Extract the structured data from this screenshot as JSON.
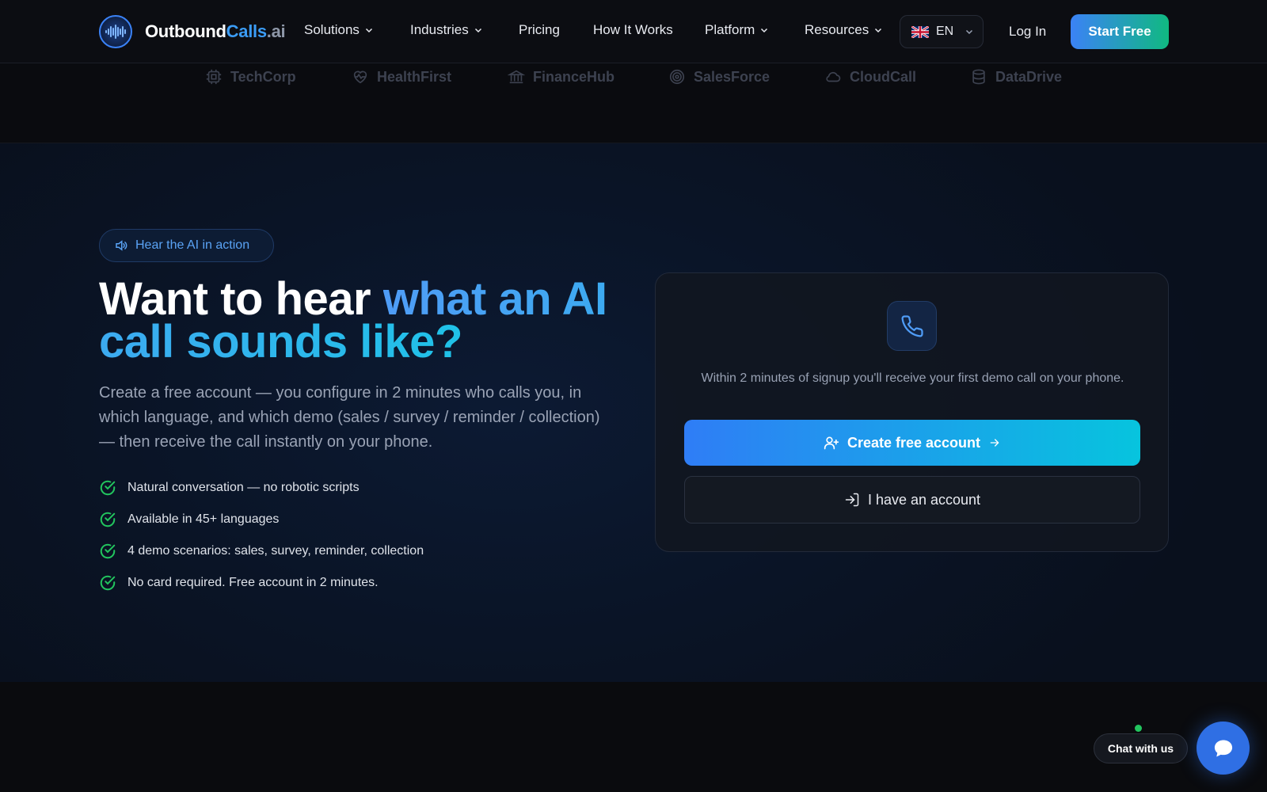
{
  "brand": {
    "part1": "Outbound",
    "part2": "Calls",
    "part3": ".ai"
  },
  "nav": {
    "solutions": "Solutions",
    "industries": "Industries",
    "pricing": "Pricing",
    "how_it_works": "How It Works",
    "platform": "Platform",
    "resources": "Resources",
    "language": "EN",
    "login": "Log In",
    "start": "Start Free"
  },
  "logos": [
    "TechCorp",
    "HealthFirst",
    "FinanceHub",
    "SalesForce",
    "CloudCall",
    "DataDrive"
  ],
  "hero": {
    "pill": "Hear the AI in action",
    "headline_white": "Want to hear ",
    "headline_accent": "what an AI call sounds like?",
    "subtitle": "Create a free account — you configure in 2 minutes who calls you, in which language, and which demo (sales / survey / reminder / collection) — then receive the call instantly on your phone.",
    "checks": [
      "Natural conversation — no robotic scripts",
      "Available in 45+ languages",
      "4 demo scenarios: sales, survey, reminder, collection",
      "No card required. Free account in 2 minutes."
    ]
  },
  "card": {
    "text": "Within 2 minutes of signup you'll receive your first demo call on your phone.",
    "create_label": "Create free account",
    "account_label": "I have an account"
  },
  "chat": {
    "label": "Chat with us"
  },
  "colors": {
    "accent_blue": "#3b82f6",
    "accent_cyan": "#07c4de",
    "accent_green": "#22c55e",
    "bg": "#0b0c10"
  }
}
